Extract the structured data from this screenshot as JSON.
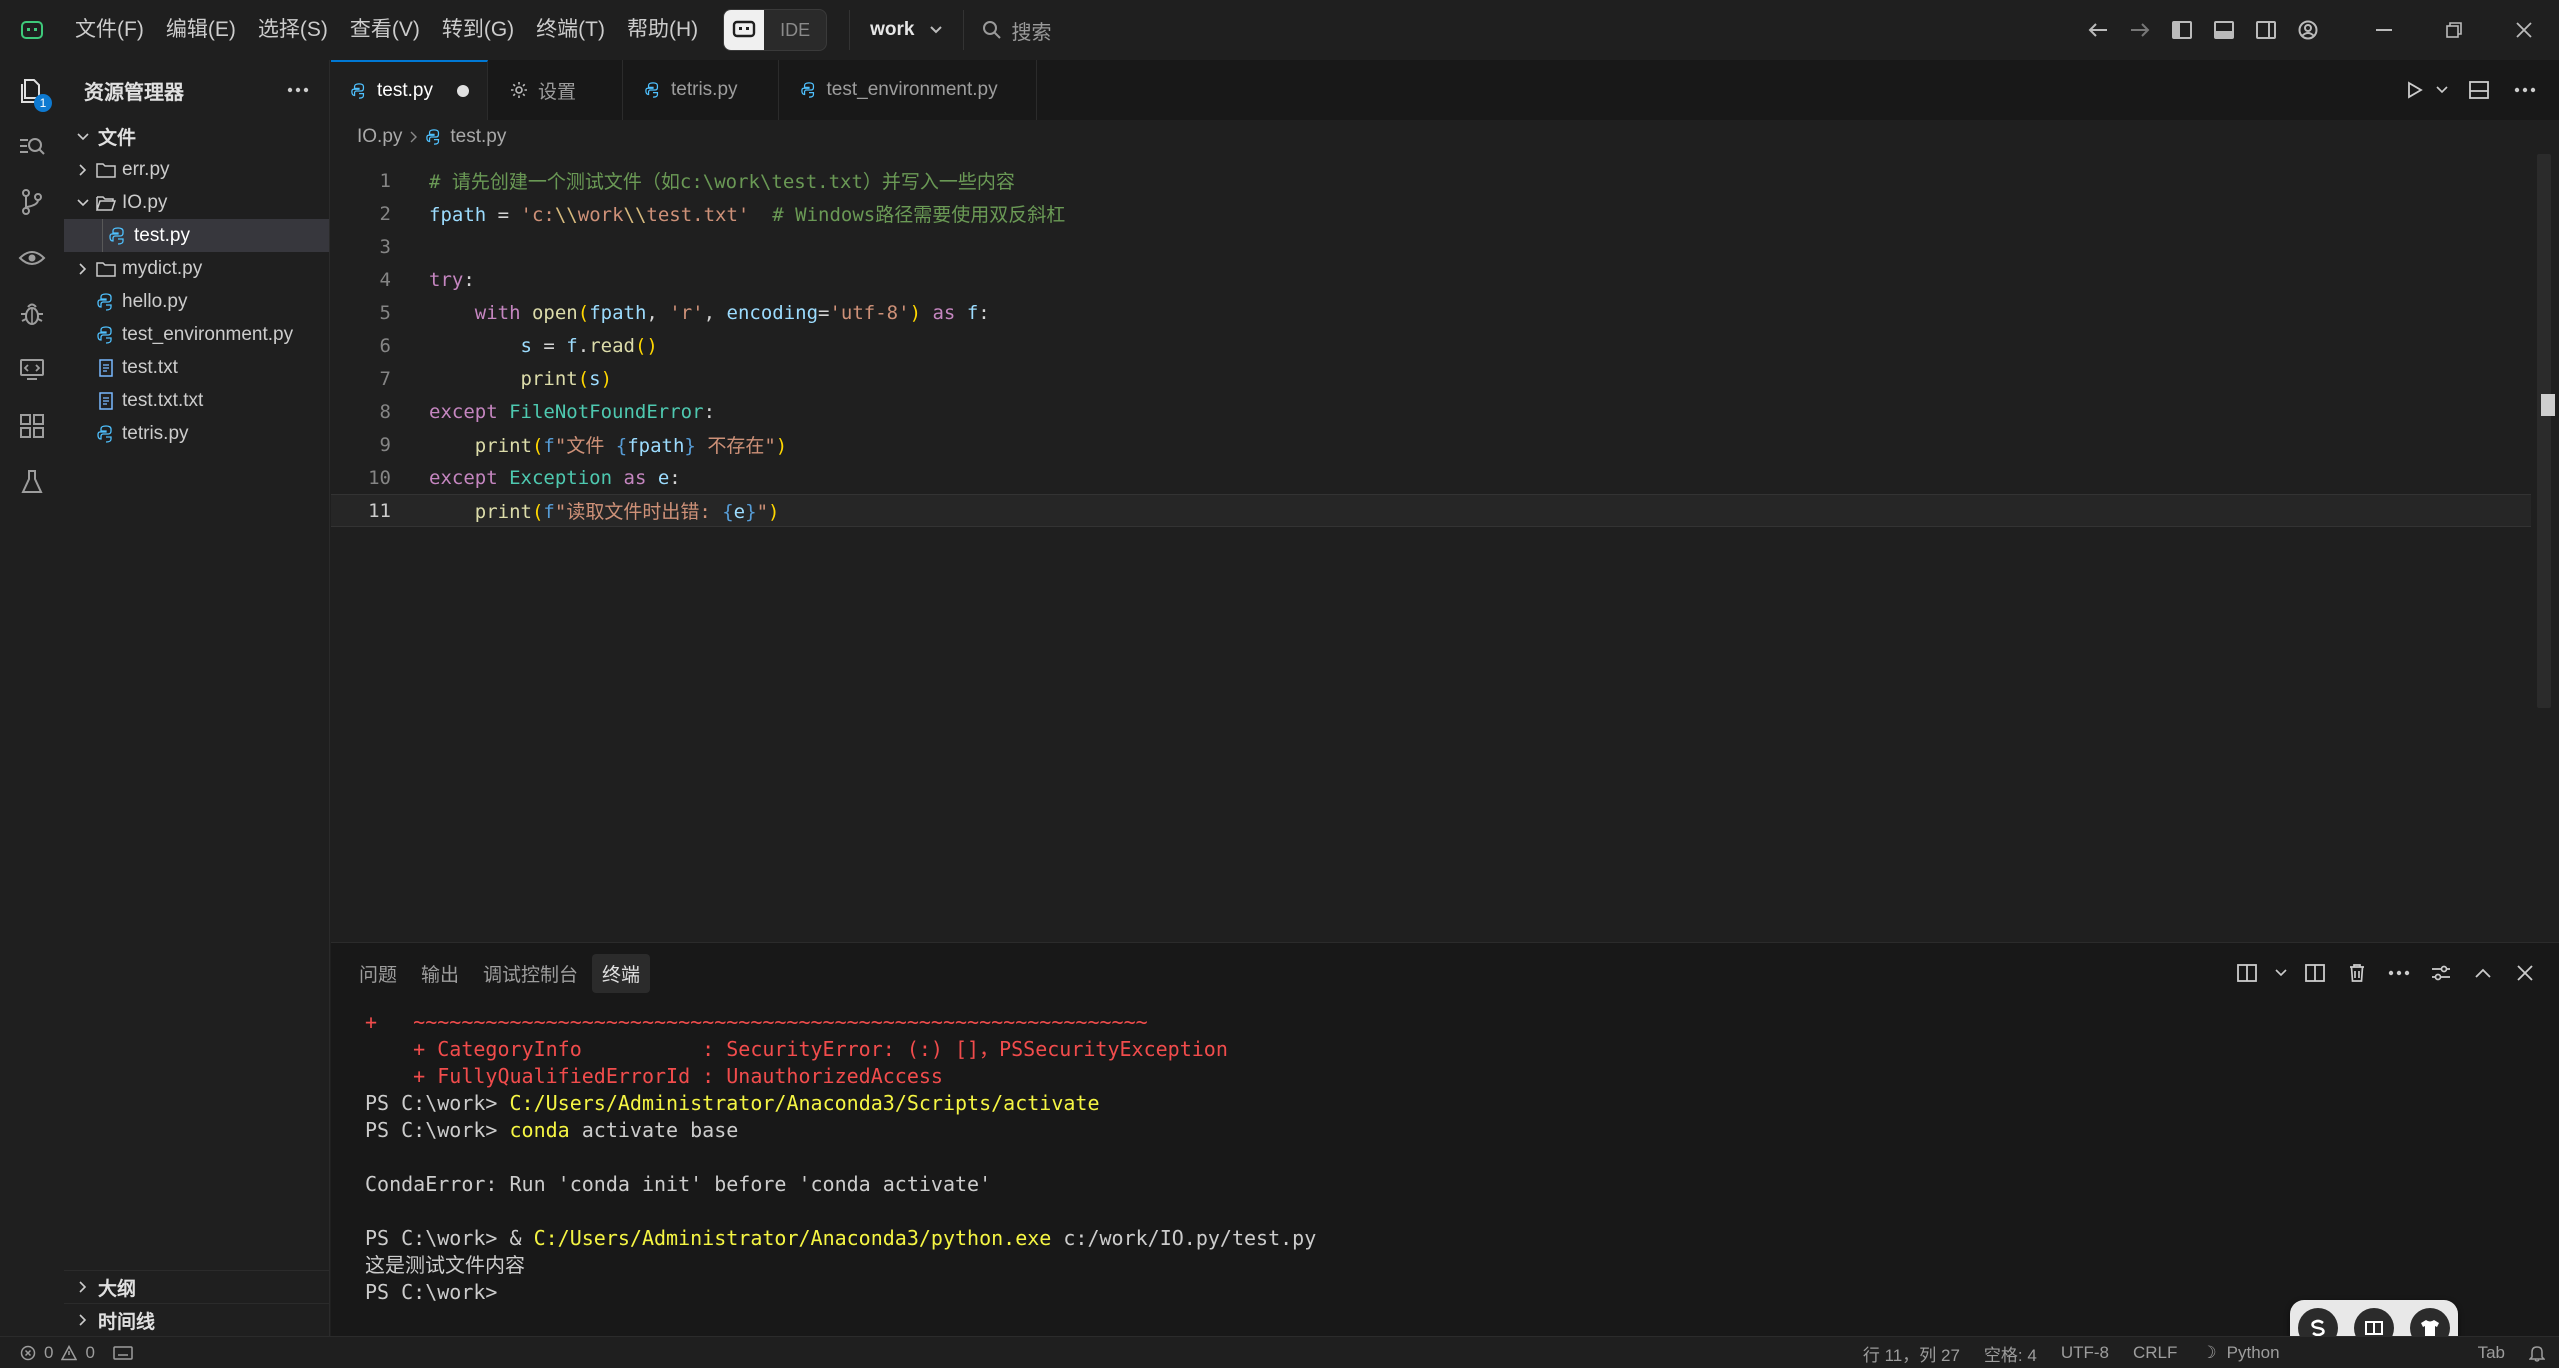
{
  "titlebar": {
    "menus": [
      "文件(F)",
      "编辑(E)",
      "选择(S)",
      "查看(V)",
      "转到(G)",
      "终端(T)",
      "帮助(H)"
    ],
    "ide_label": "IDE",
    "workspace": "work",
    "search_placeholder": "搜索"
  },
  "activity": {
    "explorer_badge": "1"
  },
  "sidebar": {
    "title": "资源管理器",
    "root": "文件",
    "items": [
      {
        "label": "err.py",
        "kind": "folder"
      },
      {
        "label": "IO.py",
        "kind": "folder-open"
      },
      {
        "label": "test.py",
        "kind": "python"
      },
      {
        "label": "mydict.py",
        "kind": "folder"
      },
      {
        "label": "hello.py",
        "kind": "python"
      },
      {
        "label": "test_environment.py",
        "kind": "python"
      },
      {
        "label": "test.txt",
        "kind": "text"
      },
      {
        "label": "test.txt.txt",
        "kind": "text"
      },
      {
        "label": "tetris.py",
        "kind": "python"
      }
    ],
    "outline": "大纲",
    "timeline": "时间线"
  },
  "tabs": [
    {
      "label": "test.py",
      "active": true,
      "modified": true
    },
    {
      "label": "设置",
      "active": false
    },
    {
      "label": "tetris.py",
      "active": false
    },
    {
      "label": "test_environment.py",
      "active": false
    }
  ],
  "breadcrumb": [
    "IO.py",
    "test.py"
  ],
  "editor": {
    "line_numbers": [
      "1",
      "2",
      "3",
      "4",
      "5",
      "6",
      "7",
      "8",
      "9",
      "10",
      "11"
    ]
  },
  "panel": {
    "tabs": [
      "问题",
      "输出",
      "调试控制台",
      "终端"
    ],
    "active_tab": "终端"
  },
  "statusbar": {
    "errors": "0",
    "warnings": "0",
    "position": "行 11，列 27",
    "spaces": "空格: 4",
    "encoding": "UTF-8",
    "eol": "CRLF",
    "language": "Python",
    "indent": "Tab"
  },
  "colors": {
    "accent": "#0078d4",
    "background": "#1f1f1f",
    "error_text": "#f14c4c",
    "command_text": "#f5f543"
  }
}
